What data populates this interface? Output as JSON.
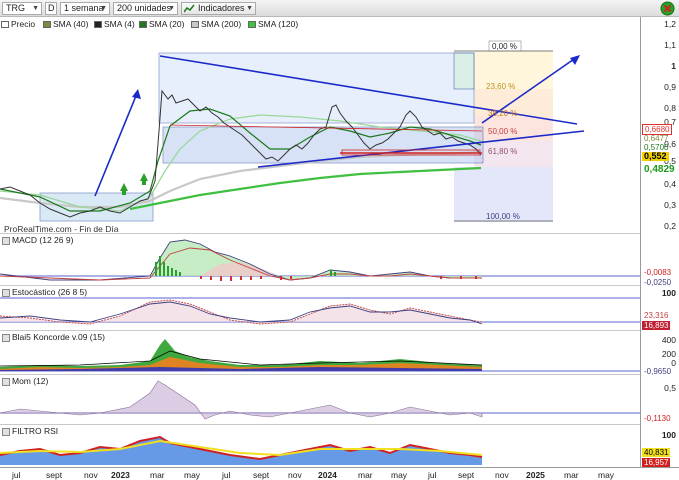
{
  "toolbar": {
    "symbol": "TRG",
    "mode": "D",
    "period": "1 semana",
    "units": "200 unidades",
    "indicators": "Indicadores"
  },
  "legend": [
    {
      "label": "Precio",
      "color": "#ffffff"
    },
    {
      "label": "SMA (40)",
      "color": "#7a8c3a"
    },
    {
      "label": "SMA (4)",
      "color": "#222222"
    },
    {
      "label": "SMA (20)",
      "color": "#1c7a1c"
    },
    {
      "label": "SMA (200)",
      "color": "#c8c8c8"
    },
    {
      "label": "SMA (120)",
      "color": "#40c040"
    }
  ],
  "watermark": "ProRealTime.com - Fin de Día",
  "fib_labels": [
    "0,00 %",
    "23,60 %",
    "38,20 %",
    "50,00 %",
    "61,80 %",
    "100,00 %"
  ],
  "price_axis": [
    "1,2",
    "1,1",
    "1",
    "0,9",
    "0,8",
    "0,7",
    "0,6",
    "0,5",
    "0,4",
    "0,3",
    "0,2"
  ],
  "price_tags": [
    {
      "text": "0,6680",
      "color": "#e03030",
      "bg": "#ffffff"
    },
    {
      "text": "0,6477",
      "color": "#7a8c3a",
      "bg": "#ffffff"
    },
    {
      "text": "0,5700",
      "color": "#1c7a1c",
      "bg": "#ffffff"
    },
    {
      "text": "0,552",
      "color": "#000000",
      "bg": "#f0d000"
    },
    {
      "text": "0,4829",
      "color": "#1c9a1c",
      "bg": "#ffffff"
    }
  ],
  "panels": {
    "macd": {
      "title": "MACD (12 26 9)",
      "tags": [
        "-0,0083",
        "-0,0250"
      ]
    },
    "stoch": {
      "title": "Estocástico (26 8 5)",
      "axis": "100",
      "tags": [
        "23,316",
        "16,893"
      ]
    },
    "koncorde": {
      "title": "Blai5 Koncorde v.09 (15)",
      "axis": [
        "400",
        "200",
        "0"
      ],
      "tags": [
        "-0,9650"
      ]
    },
    "mom": {
      "title": "Mom (12)",
      "axis": [
        "0,5"
      ],
      "tags": [
        "-0,1130"
      ]
    },
    "rsi": {
      "title": "FILTRO RSI",
      "axis": [
        "100"
      ],
      "tags": [
        "40,831",
        "16,957"
      ]
    }
  },
  "x_axis": [
    {
      "label": "jul",
      "bold": false
    },
    {
      "label": "sept",
      "bold": false
    },
    {
      "label": "nov",
      "bold": false
    },
    {
      "label": "2023",
      "bold": true
    },
    {
      "label": "mar",
      "bold": false
    },
    {
      "label": "may",
      "bold": false
    },
    {
      "label": "jul",
      "bold": false
    },
    {
      "label": "sept",
      "bold": false
    },
    {
      "label": "nov",
      "bold": false
    },
    {
      "label": "2024",
      "bold": true
    },
    {
      "label": "mar",
      "bold": false
    },
    {
      "label": "may",
      "bold": false
    },
    {
      "label": "jul",
      "bold": false
    },
    {
      "label": "sept",
      "bold": false
    },
    {
      "label": "nov",
      "bold": false
    },
    {
      "label": "2025",
      "bold": true
    },
    {
      "label": "mar",
      "bold": false
    },
    {
      "label": "may",
      "bold": false
    }
  ]
}
